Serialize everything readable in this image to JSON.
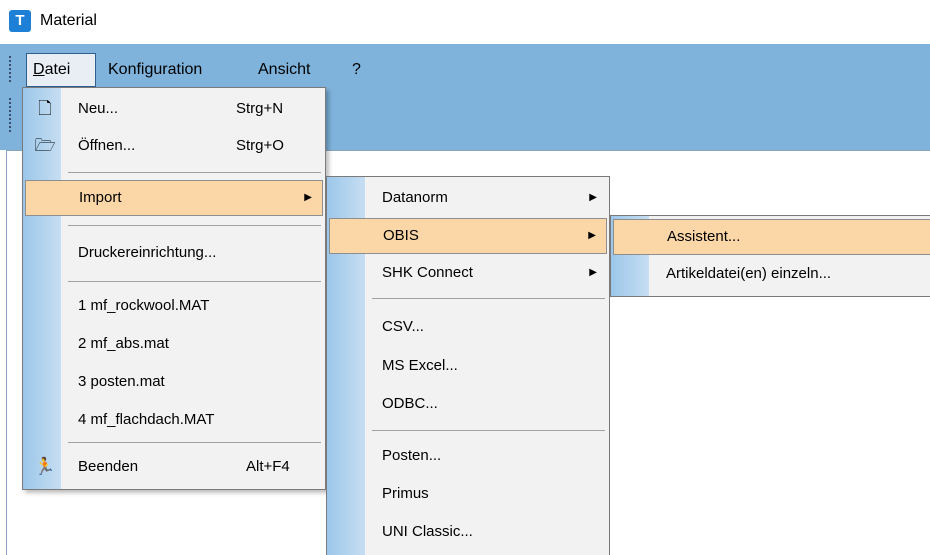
{
  "window": {
    "title": "Material"
  },
  "menubar": {
    "datei": "Datei",
    "konfiguration": "Konfiguration",
    "ansicht": "Ansicht",
    "help": "?"
  },
  "datei_menu": {
    "neu": "Neu...",
    "neu_shortcut": "Strg+N",
    "oeffnen": "Öffnen...",
    "oeffnen_shortcut": "Strg+O",
    "import": "Import",
    "druckereinrichtung": "Druckereinrichtung...",
    "recent_1": "1 mf_rockwool.MAT",
    "recent_2": "2 mf_abs.mat",
    "recent_3": "3 posten.mat",
    "recent_4": "4 mf_flachdach.MAT",
    "beenden": "Beenden",
    "beenden_shortcut": "Alt+F4"
  },
  "import_menu": {
    "datanorm": "Datanorm",
    "obis": "OBIS",
    "shk_connect": "SHK Connect",
    "csv": "CSV...",
    "ms_excel": "MS Excel...",
    "odbc": "ODBC...",
    "posten": "Posten...",
    "primus": "Primus",
    "uni_classic": "UNI Classic..."
  },
  "obis_menu": {
    "assistent": "Assistent...",
    "artikeldatei": "Artikeldatei(en) einzeln..."
  },
  "colors": {
    "menubar": "#7fb3dc",
    "highlight": "#fbd7a8",
    "menu_bg": "#f2f2f2"
  }
}
